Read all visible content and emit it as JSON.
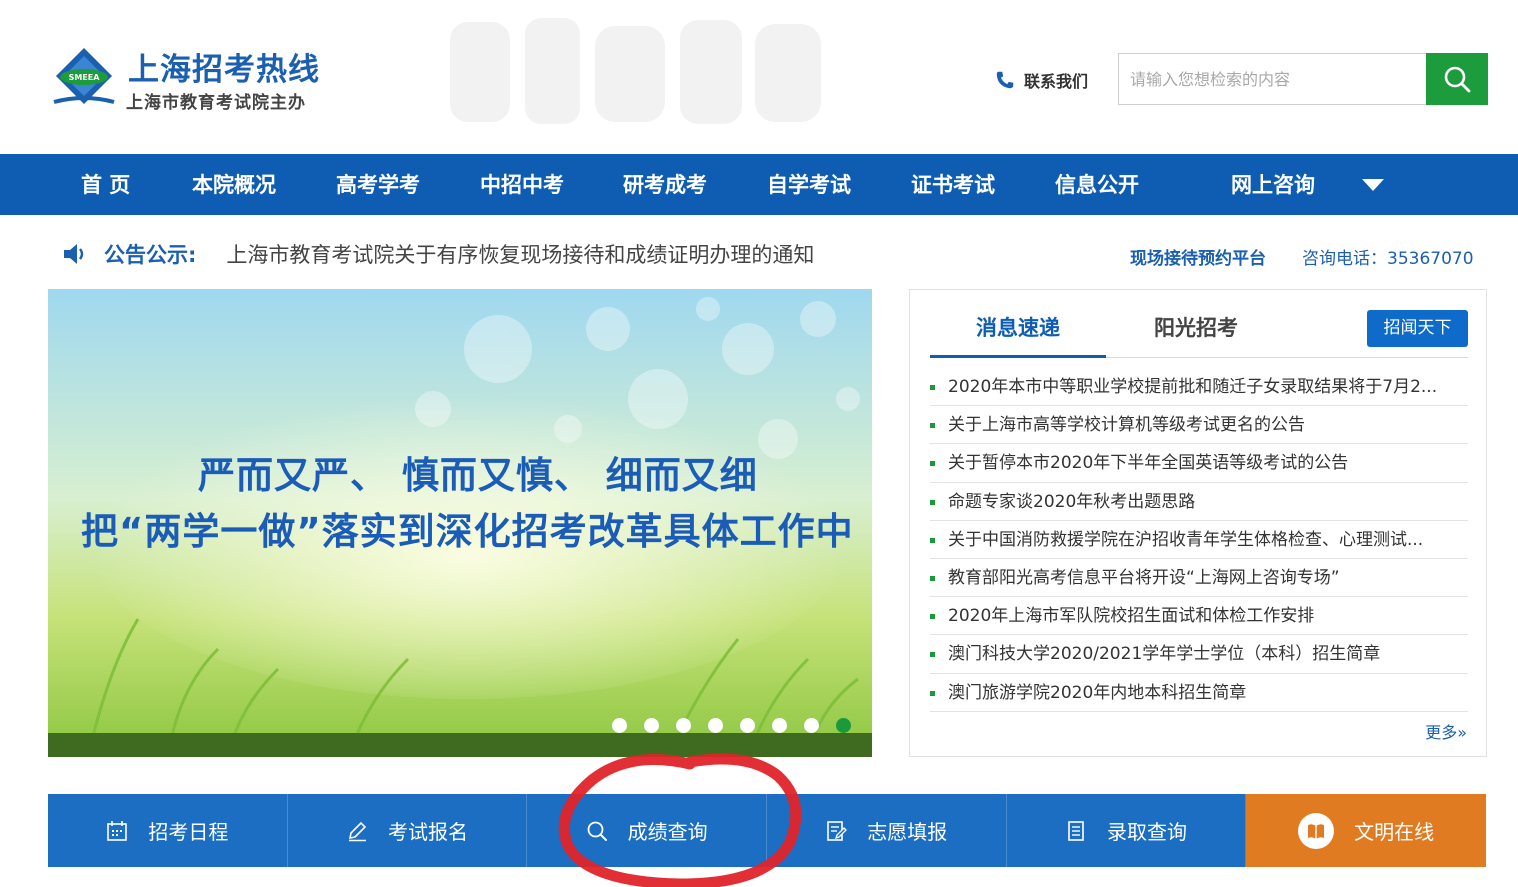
{
  "header": {
    "site_title": "上海招考热线",
    "site_subtitle": "上海市教育考试院主办",
    "logo_text": "SMEEA",
    "contact_label": "联系我们",
    "search": {
      "placeholder": "请输入您想检索的内容"
    }
  },
  "nav": {
    "items": [
      {
        "label": "首 页"
      },
      {
        "label": "本院概况"
      },
      {
        "label": "高考学考"
      },
      {
        "label": "中招中考"
      },
      {
        "label": "研考成考"
      },
      {
        "label": "自学考试"
      },
      {
        "label": "证书考试"
      },
      {
        "label": "信息公开"
      },
      {
        "label": "网上咨询"
      }
    ]
  },
  "notice": {
    "title": "公告公示:",
    "text": "上海市教育考试院关于有序恢复现场接待和成绩证明办理的通知",
    "reception_link": "现场接待预约平台",
    "hotline": "咨询电话：35367070"
  },
  "banner": {
    "line1": "严而又严、 慎而又慎、 细而又细",
    "line2": "把“两学一做”落实到深化招考改革具体工作中",
    "slide_count": 8,
    "active_slide": 8
  },
  "news": {
    "tabs": [
      {
        "label": "消息速递",
        "active": true
      },
      {
        "label": "阳光招考",
        "active": false
      }
    ],
    "tab_button": "招闻天下",
    "items": [
      "2020年本市中等职业学校提前批和随迁子女录取结果将于7月2...",
      "关于上海市高等学校计算机等级考试更名的公告",
      "关于暂停本市2020年下半年全国英语等级考试的公告",
      "命题专家谈2020年秋考出题思路",
      "关于中国消防救援学院在沪招收青年学生体格检查、心理测试...",
      "教育部阳光高考信息平台将开设“上海网上咨询专场”",
      "2020年上海市军队院校招生面试和体检工作安排",
      "澳门科技大学2020/2021学年学士学位（本科）招生简章",
      "澳门旅游学院2020年内地本科招生简章"
    ],
    "more": "更多»"
  },
  "quick_links": [
    {
      "label": "招考日程",
      "icon": "calendar-icon"
    },
    {
      "label": "考试报名",
      "icon": "pencil-icon"
    },
    {
      "label": "成绩查询",
      "icon": "search-icon"
    },
    {
      "label": "志愿填报",
      "icon": "form-icon"
    },
    {
      "label": "录取查询",
      "icon": "document-icon"
    },
    {
      "label": "文明在线",
      "icon": "book-icon"
    }
  ],
  "colors": {
    "brand_blue": "#0e5db3",
    "quick_blue": "#1b6ec2",
    "accent_green": "#1c9c3c",
    "accent_orange": "#e07b22",
    "annotation_red": "#e0242a"
  }
}
